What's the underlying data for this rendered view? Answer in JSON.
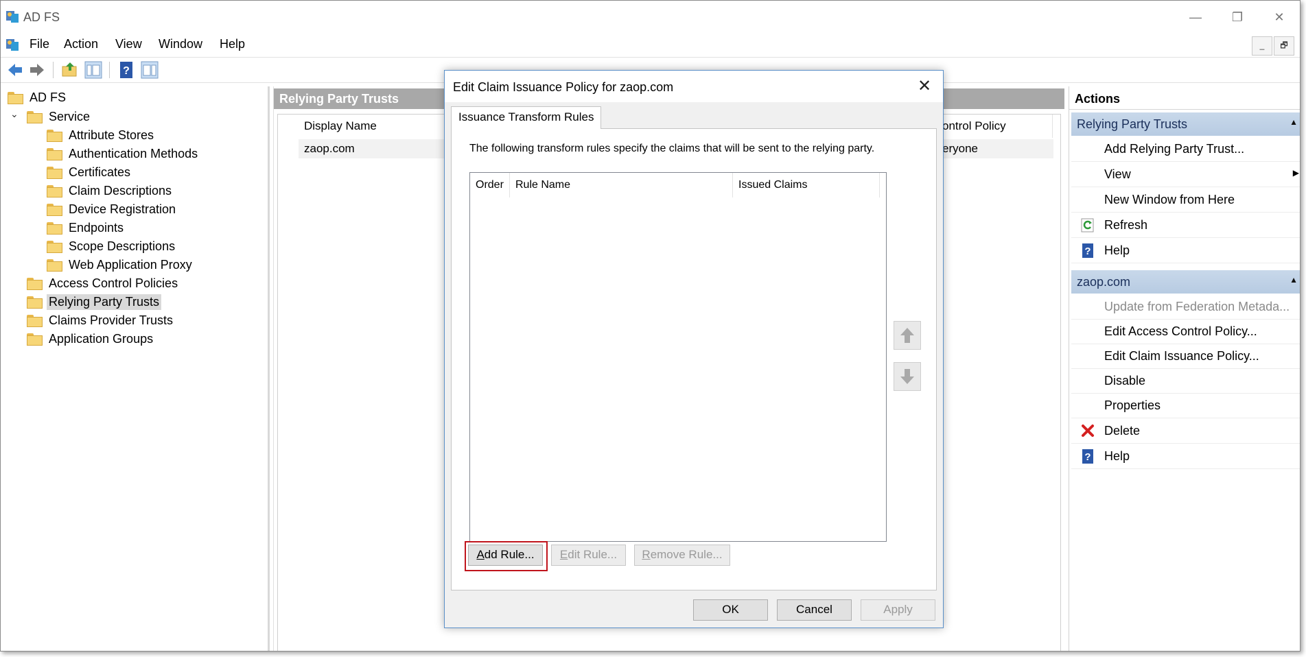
{
  "app": {
    "title": "AD FS"
  },
  "window_controls": {
    "minimize": "—",
    "restore": "❐",
    "close": "✕"
  },
  "menu": [
    "File",
    "Action",
    "View",
    "Window",
    "Help"
  ],
  "mdi_controls": {
    "minimize": "_",
    "restore": "🗗"
  },
  "tree": {
    "root": "AD FS",
    "service": "Service",
    "service_children": [
      "Attribute Stores",
      "Authentication Methods",
      "Certificates",
      "Claim Descriptions",
      "Device Registration",
      "Endpoints",
      "Scope Descriptions",
      "Web Application Proxy"
    ],
    "top_items": [
      "Access Control Policies",
      "Relying Party Trusts",
      "Claims Provider Trusts",
      "Application Groups"
    ],
    "selected": "Relying Party Trusts"
  },
  "middle": {
    "header": "Relying Party Trusts",
    "columns": {
      "display_name": "Display Name",
      "control_policy": "ontrol Policy"
    },
    "row": {
      "display_name": "zaop.com",
      "control_policy": "eryone"
    }
  },
  "actions": {
    "title": "Actions",
    "section1": {
      "label": "Relying Party Trusts",
      "items": [
        {
          "label": "Add Relying Party Trust...",
          "icon": "none",
          "disabled": false
        },
        {
          "label": "View",
          "icon": "none",
          "disabled": false
        },
        {
          "label": "New Window from Here",
          "icon": "none",
          "disabled": false
        },
        {
          "label": "Refresh",
          "icon": "refresh-icon",
          "disabled": false
        },
        {
          "label": "Help",
          "icon": "help-icon",
          "disabled": false
        }
      ]
    },
    "section2": {
      "label": "zaop.com",
      "items": [
        {
          "label": "Update from Federation Metada...",
          "icon": "none",
          "disabled": true
        },
        {
          "label": "Edit Access Control Policy...",
          "icon": "none",
          "disabled": false
        },
        {
          "label": "Edit Claim Issuance Policy...",
          "icon": "none",
          "disabled": false
        },
        {
          "label": "Disable",
          "icon": "none",
          "disabled": false
        },
        {
          "label": "Properties",
          "icon": "none",
          "disabled": false
        },
        {
          "label": "Delete",
          "icon": "delete-icon",
          "disabled": false
        },
        {
          "label": "Help",
          "icon": "help-icon",
          "disabled": false
        }
      ]
    }
  },
  "dialog": {
    "title": "Edit Claim Issuance Policy for zaop.com",
    "close": "✕",
    "tab": "Issuance Transform Rules",
    "description": "The following transform rules specify the claims that will be sent to the relying party.",
    "columns": [
      "Order",
      "Rule Name",
      "Issued Claims"
    ],
    "buttons": {
      "add_rule_u": "A",
      "add_rule_rest": "dd Rule...",
      "edit_rule_u": "E",
      "edit_rule_rest": "dit Rule...",
      "remove_rule_u": "R",
      "remove_rule_rest": "emove Rule...",
      "ok": "OK",
      "cancel": "Cancel",
      "apply": "Apply"
    }
  },
  "colors": {
    "accent_blue": "#5a8fc8",
    "highlight_red": "#c0141c",
    "section_bg": "#b7cbe2"
  }
}
